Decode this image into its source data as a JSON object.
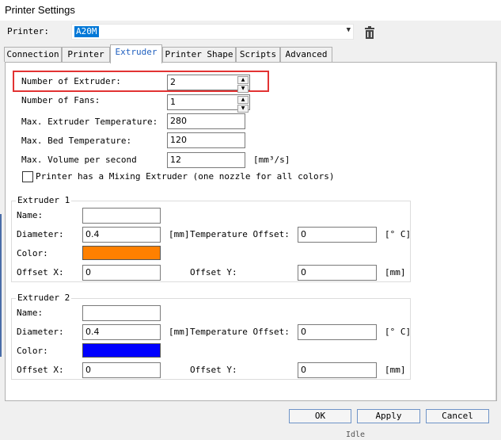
{
  "window": {
    "title": "Printer Settings"
  },
  "printer": {
    "label": "Printer:",
    "selected": "A20M"
  },
  "tabs": [
    "Connection",
    "Printer",
    "Extruder",
    "Printer Shape",
    "Scripts",
    "Advanced"
  ],
  "active_tab": "Extruder",
  "extruder_settings": {
    "num_extruders": {
      "label": "Number of Extruder:",
      "value": "2"
    },
    "num_fans": {
      "label": "Number of Fans:",
      "value": "1"
    },
    "max_extruder_temp": {
      "label": "Max. Extruder Temperature:",
      "value": "280"
    },
    "max_bed_temp": {
      "label": "Max. Bed Temperature:",
      "value": "120"
    },
    "max_volume": {
      "label": "Max. Volume per second",
      "value": "12",
      "unit": "[mm³/s]"
    },
    "mixing": {
      "label": "Printer has a Mixing Extruder (one nozzle for all colors)",
      "checked": false
    }
  },
  "extruders": [
    {
      "title": "Extruder 1",
      "name_label": "Name:",
      "name_value": "",
      "diameter_label": "Diameter:",
      "diameter_value": "0.4",
      "diameter_unit": "[mm]",
      "temp_offset_label": "Temperature Offset:",
      "temp_offset_value": "0",
      "temp_unit": "[° C]",
      "color_label": "Color:",
      "color": "#ff8000",
      "offset_x_label": "Offset X:",
      "offset_x_value": "0",
      "offset_y_label": "Offset Y:",
      "offset_y_value": "0",
      "offset_unit": "[mm]"
    },
    {
      "title": "Extruder 2",
      "name_label": "Name:",
      "name_value": "",
      "diameter_label": "Diameter:",
      "diameter_value": "0.4",
      "diameter_unit": "[mm]",
      "temp_offset_label": "Temperature Offset:",
      "temp_offset_value": "0",
      "temp_unit": "[° C]",
      "color_label": "Color:",
      "color": "#0000ff",
      "offset_x_label": "Offset X:",
      "offset_x_value": "0",
      "offset_y_label": "Offset Y:",
      "offset_y_value": "0",
      "offset_unit": "[mm]"
    }
  ],
  "buttons": {
    "ok": "OK",
    "apply": "Apply",
    "cancel": "Cancel"
  },
  "status_text": "Idle",
  "colors": {
    "highlight": "#e23333",
    "selection": "#0078d7",
    "active_tab_text": "#1f5fbf"
  }
}
